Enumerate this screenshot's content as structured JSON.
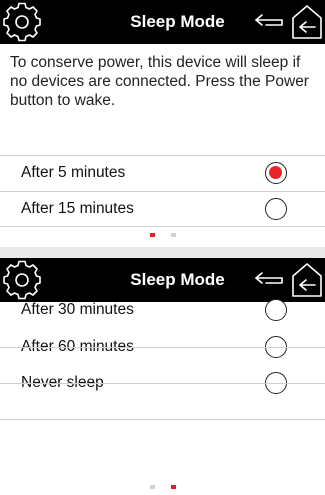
{
  "screens": [
    {
      "header": {
        "title": "Sleep Mode"
      },
      "description": "To conserve power, this device will sleep if no devices are connected. Press the Power button to wake.",
      "options": [
        {
          "label": "After 5 minutes",
          "selected": true
        },
        {
          "label": "After 15 minutes",
          "selected": false
        }
      ],
      "page_indicator": {
        "current": 1,
        "total": 2
      }
    },
    {
      "header": {
        "title": "Sleep Mode"
      },
      "options": [
        {
          "label": "After 30 minutes",
          "selected": false
        },
        {
          "label": "After 60 minutes",
          "selected": false
        },
        {
          "label": "Never sleep",
          "selected": false
        }
      ],
      "page_indicator": {
        "current": 2,
        "total": 2
      }
    }
  ],
  "colors": {
    "header_bg": "#000000",
    "accent": "#e8262a",
    "divider": "#cfcfcf"
  },
  "icons": {
    "settings": "gear-icon",
    "back": "back-arrow-icon",
    "home": "home-icon"
  }
}
